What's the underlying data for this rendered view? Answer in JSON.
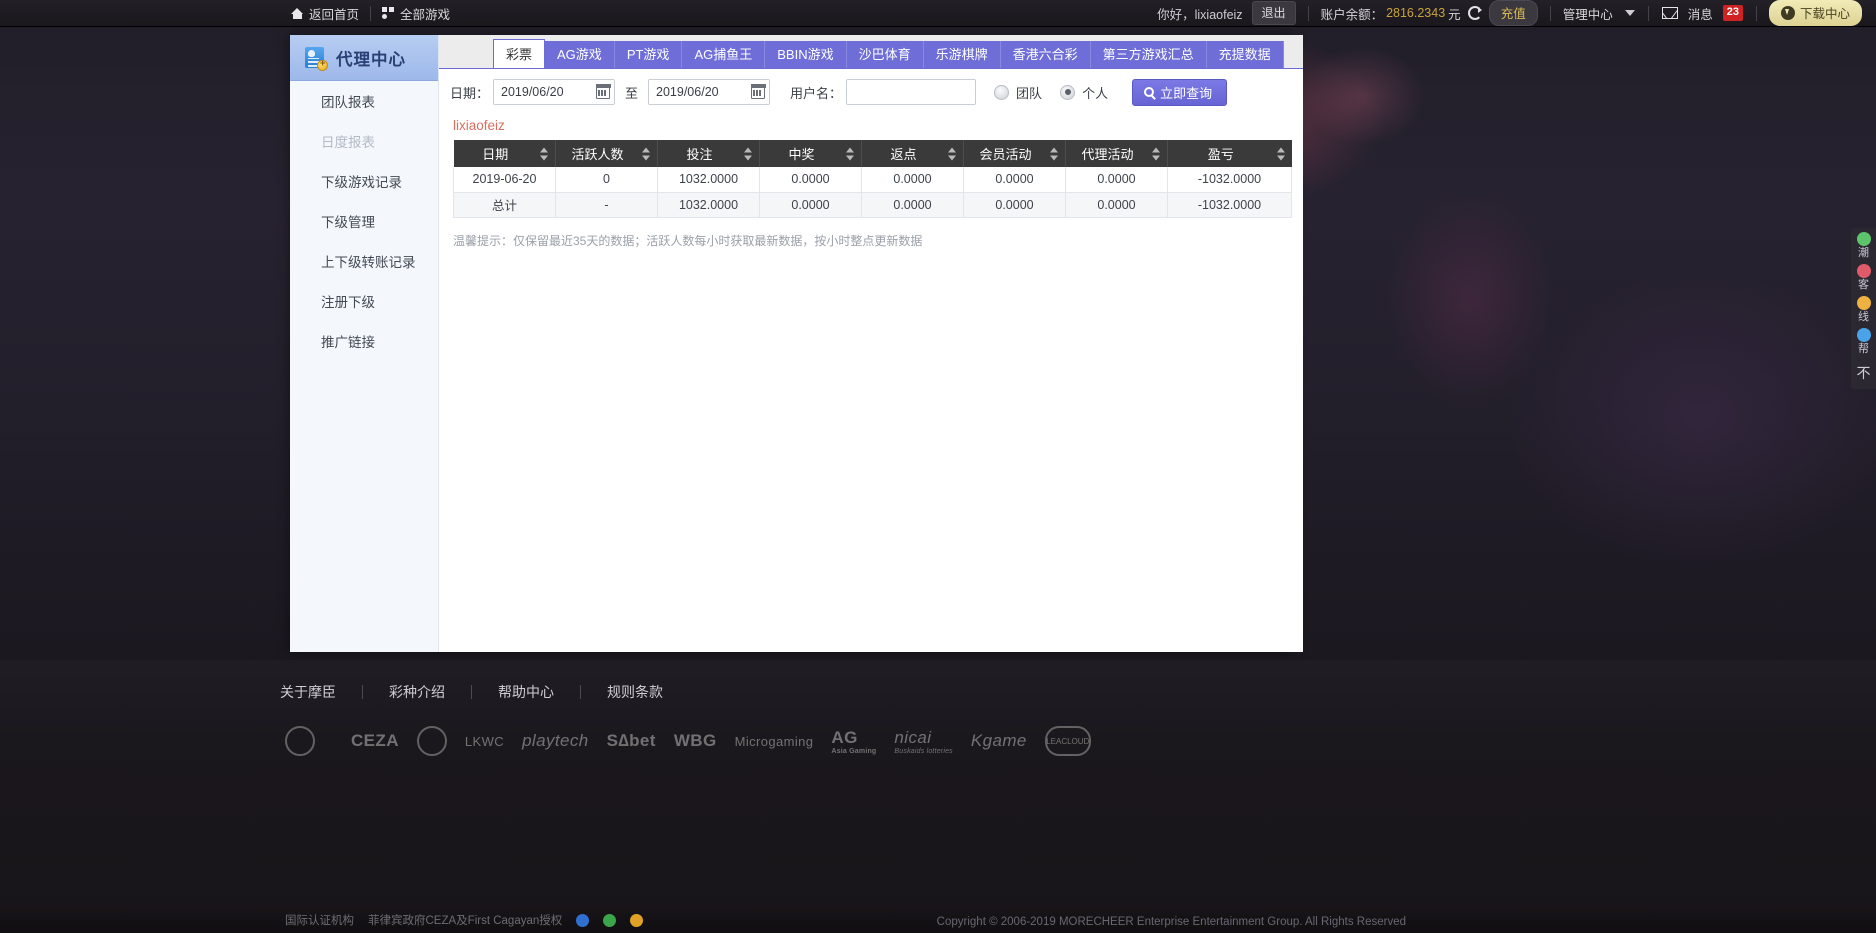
{
  "topbar": {
    "home_label": "返回首页",
    "home_icon": "home-icon",
    "all_games_label": "全部游戏",
    "all_games_icon": "grid-icon",
    "greeting": "你好，lixiaofeiz",
    "logout_label": "退出",
    "balance_label": "账户余额：",
    "balance_value": "2816.2343",
    "balance_unit": "元",
    "refresh_icon": "refresh-icon",
    "recharge_label": "充值",
    "admin_center_label": "管理中心",
    "caret_icon": "chevron-down-icon",
    "mail_icon": "mail-icon",
    "message_label": "消息",
    "message_count": "23",
    "download_label": "下载中心",
    "download_icon": "download-circle-icon",
    "accent_balance": "#c9a23b",
    "accent_badge": "#cf2222"
  },
  "sidebar": {
    "title": "代理中心",
    "title_icon": "agent-card-icon",
    "items": [
      {
        "label": "团队报表",
        "active": false
      },
      {
        "label": "日度报表",
        "active": true
      },
      {
        "label": "下级游戏记录",
        "active": false
      },
      {
        "label": "下级管理",
        "active": false
      },
      {
        "label": "上下级转账记录",
        "active": false
      },
      {
        "label": "注册下级",
        "active": false
      },
      {
        "label": "推广链接",
        "active": false
      }
    ]
  },
  "tabs": [
    {
      "label": "彩票",
      "active": true
    },
    {
      "label": "AG游戏",
      "active": false
    },
    {
      "label": "PT游戏",
      "active": false
    },
    {
      "label": "AG捕鱼王",
      "active": false
    },
    {
      "label": "BBIN游戏",
      "active": false
    },
    {
      "label": "沙巴体育",
      "active": false
    },
    {
      "label": "乐游棋牌",
      "active": false
    },
    {
      "label": "香港六合彩",
      "active": false
    },
    {
      "label": "第三方游戏汇总",
      "active": false
    },
    {
      "label": "充提数据",
      "active": false
    }
  ],
  "filter": {
    "date_label": "日期：",
    "date_from": "2019/06/20",
    "date_to": "2019/06/20",
    "date_placeholder": "",
    "to_label": "至",
    "calendar_icon": "calendar-icon",
    "user_label": "用户名：",
    "user_value": "",
    "user_placeholder": "",
    "radio_team_label": "团队",
    "radio_person_label": "个人",
    "radio_selected": "个人",
    "query_label": "立即查询",
    "query_icon": "search-icon",
    "accent_button": "#6765d4"
  },
  "report": {
    "username": "lixiaofeiz",
    "columns": [
      "日期",
      "活跃人数",
      "投注",
      "中奖",
      "返点",
      "会员活动",
      "代理活动",
      "盈亏"
    ],
    "rows": [
      [
        "2019-06-20",
        "0",
        "1032.0000",
        "0.0000",
        "0.0000",
        "0.0000",
        "0.0000",
        "-1032.0000"
      ],
      [
        "总计",
        "-",
        "1032.0000",
        "0.0000",
        "0.0000",
        "0.0000",
        "0.0000",
        "-1032.0000"
      ]
    ],
    "tip": "温馨提示：仅保留最近35天的数据；活跃人数每小时获取最新数据，按小时整点更新数据"
  },
  "side_widgets": {
    "items": [
      {
        "label": "潮",
        "color": "#5cc46b",
        "icon": "chat-bubble-icon"
      },
      {
        "label": "客",
        "color": "#e05b6a",
        "icon": "headset-icon"
      },
      {
        "label": "线",
        "color": "#efb13f",
        "icon": "online-icon"
      },
      {
        "label": "帮",
        "color": "#4aa3e8",
        "icon": "help-icon"
      }
    ],
    "close_label": "不",
    "close_icon": "close-icon"
  },
  "footer": {
    "links": [
      "关于摩臣",
      "彩种介绍",
      "帮助中心",
      "规则条款"
    ],
    "logos": [
      {
        "text": "",
        "kind": "circle",
        "name": "gaming-authority-logo"
      },
      {
        "text": "",
        "kind": "text",
        "name": "first-cagayan-logo"
      },
      {
        "text": "CEZA",
        "kind": "big",
        "name": "ceza-logo"
      },
      {
        "text": "",
        "kind": "crest",
        "name": "crest-logo"
      },
      {
        "text": "LKWC",
        "kind": "text",
        "name": "lkwc-logo"
      },
      {
        "text": "playtech",
        "kind": "script",
        "name": "playtech-logo"
      },
      {
        "text": "S∆bet",
        "kind": "big",
        "name": "sabet-logo"
      },
      {
        "text": "WBG",
        "kind": "big",
        "name": "wbg-logo"
      },
      {
        "text": "Microgaming",
        "kind": "text",
        "name": "microgaming-logo"
      },
      {
        "text": "AG",
        "kind": "ag",
        "sub": "Asia Gaming",
        "name": "asia-gaming-logo"
      },
      {
        "text": "nicai",
        "kind": "script",
        "sub": "Buskaids lotteries",
        "name": "nicai-logo"
      },
      {
        "text": "Kgame",
        "kind": "script",
        "name": "kgame-logo"
      },
      {
        "text": "LEACLOUD",
        "kind": "cloud",
        "name": "leacloud-logo"
      }
    ],
    "cert_label": "国际认证机构",
    "cert_text": "菲律宾政府CEZA及First Cagayan授权",
    "copyright": "Copyright © 2006-2019 MORECHEER Enterprise Entertainment Group. All Rights Reserved"
  }
}
